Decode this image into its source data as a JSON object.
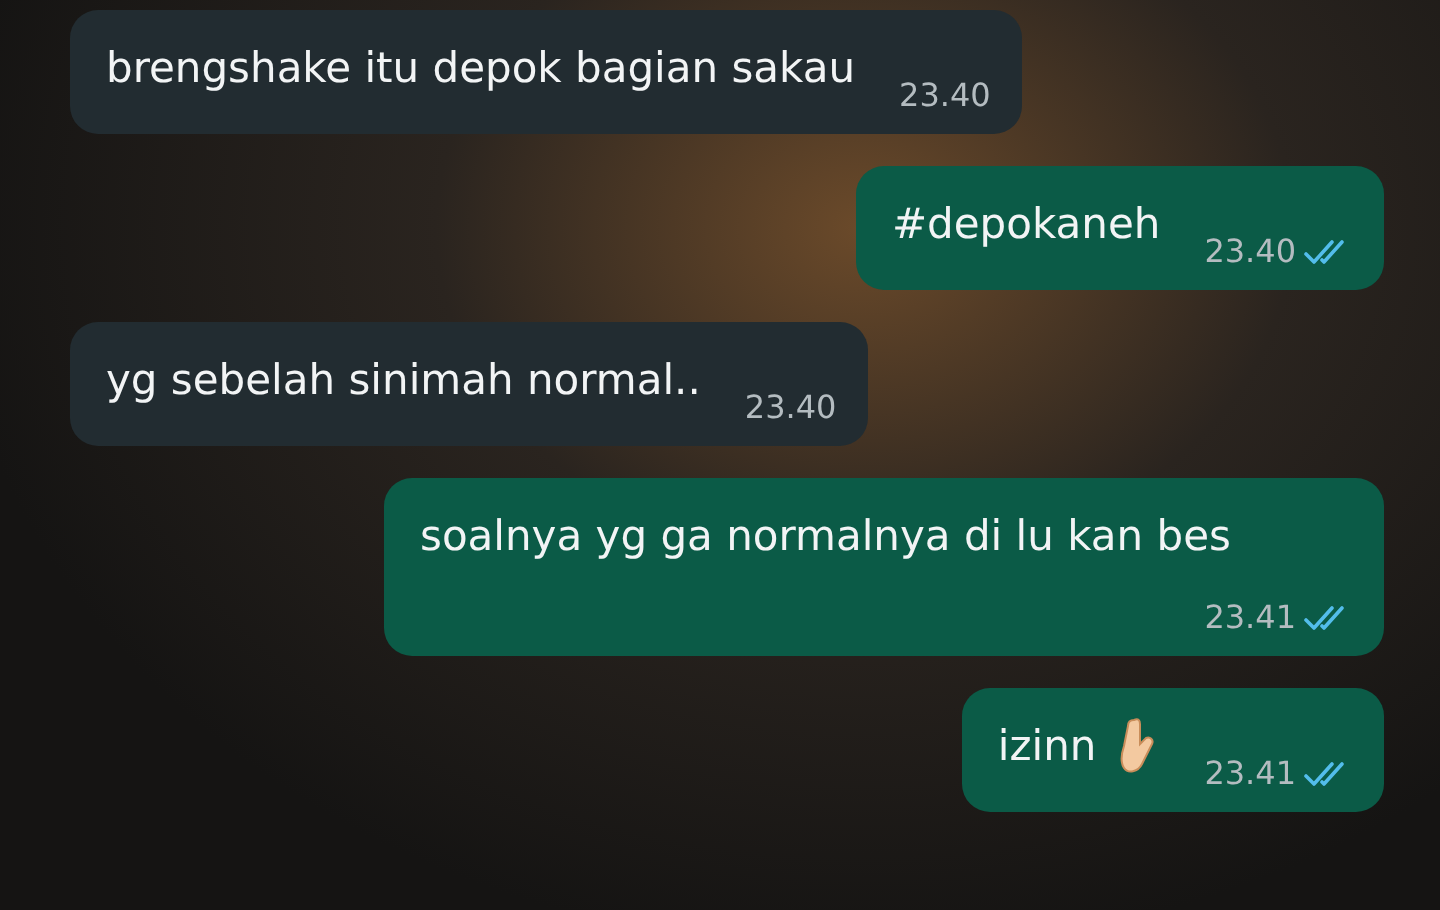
{
  "messages": [
    {
      "kind": "received",
      "text": "brengshake itu depok bagian sakau",
      "time": "23.40"
    },
    {
      "kind": "sent",
      "text": "#depokaneh",
      "time": "23.40",
      "read": true
    },
    {
      "kind": "received",
      "text": "yg sebelah sinimah normal..",
      "time": "23.40"
    },
    {
      "kind": "sent",
      "text": "soalnya yg ga normalnya di lu kan bes",
      "time": "23.41",
      "read": true
    },
    {
      "kind": "sent",
      "text": "izinn",
      "time": "23.41",
      "read": true,
      "hand_emoji": true
    }
  ]
}
